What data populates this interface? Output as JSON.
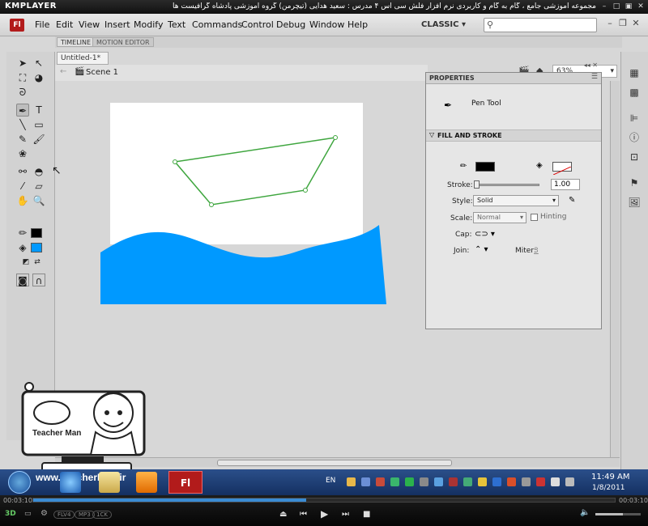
{
  "player": {
    "name": "KMPLAYER",
    "title": "مجموعه آموزشی جامع ، گام به گام و کاربردی نرم افزار فلش سی اس ۴ مدرس : سعید هدایی (تیچرمن) گروه آموزشی پادشاه گرافیست ها",
    "time_elapsed": "00:03:10",
    "time_total": "00:03:10",
    "progress": 0.47,
    "volume": 0.6,
    "badges": [
      "FLV4",
      "MP3",
      "1CK"
    ]
  },
  "app": {
    "logo": "Fl",
    "menu": [
      "File",
      "Edit",
      "View",
      "Insert",
      "Modify",
      "Text",
      "Commands",
      "Control",
      "Debug",
      "Window",
      "Help"
    ],
    "workspace": "CLASSIC",
    "search_placeholder": ""
  },
  "timeline": {
    "tabs": [
      "TIMELINE",
      "MOTION EDITOR"
    ]
  },
  "document": {
    "tab": "Untitled-1*",
    "scene": "Scene 1",
    "zoom": "63%"
  },
  "colors": {
    "stroke": "#000000",
    "fill": "#0099ff",
    "stage": "#ffffff",
    "boat_stroke": "#3fa63f"
  },
  "properties": {
    "title": "PROPERTIES",
    "tool_name": "Pen Tool",
    "section": "FILL AND STROKE",
    "stroke_label": "Stroke:",
    "stroke_value": "1.00",
    "style_label": "Style:",
    "style_value": "Solid",
    "scale_label": "Scale:",
    "scale_value": "Normal",
    "hinting_label": "Hinting",
    "cap_label": "Cap:",
    "join_label": "Join:",
    "miter_label": "Miter:",
    "miter_value": "3"
  },
  "taskbar": {
    "lang": "EN",
    "time": "11:49 AM",
    "date": "1/8/2011"
  },
  "watermark": {
    "url": "www.TeacherMan.ir",
    "brand": "Teacher Man"
  }
}
